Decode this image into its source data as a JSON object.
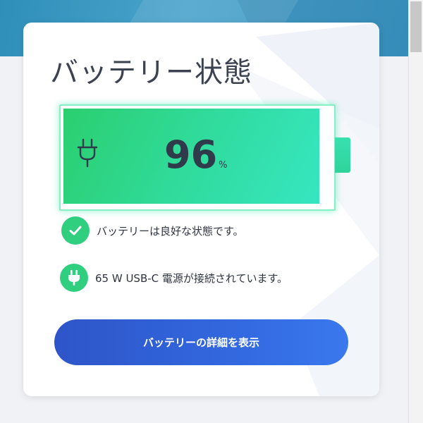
{
  "colors": {
    "accent_green": "#2fcf7f",
    "battery_gradient_start": "#2bcf6f",
    "battery_gradient_end": "#36e6c0",
    "button_gradient_start": "#2e55c8",
    "button_gradient_end": "#3a78ee",
    "text_dark": "#2f3440"
  },
  "card": {
    "title": "バッテリー状態"
  },
  "battery": {
    "level_percent": 96,
    "value": "96",
    "unit": "%",
    "icon": "plug-icon"
  },
  "status": {
    "health_icon": "check-icon",
    "health_text": "バッテリーは良好な状態です。",
    "power_icon": "plug-icon",
    "power_text": "65 W USB-C 電源が接続されています。"
  },
  "actions": {
    "details_label": "バッテリーの詳細を表示"
  }
}
